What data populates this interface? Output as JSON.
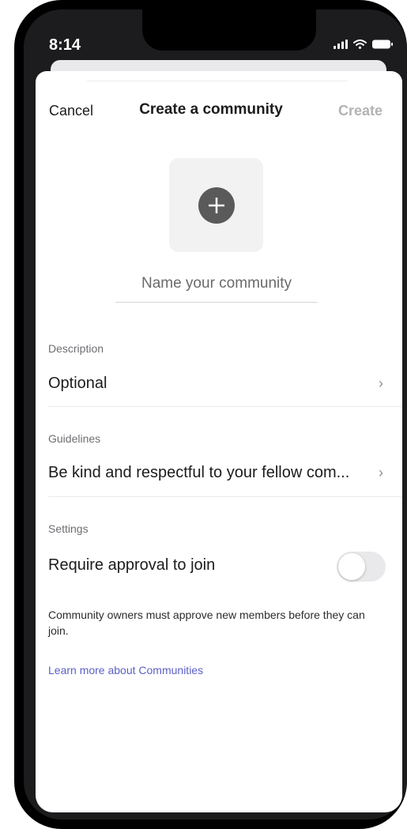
{
  "status_bar": {
    "time": "8:14"
  },
  "nav": {
    "cancel_label": "Cancel",
    "title": "Create a community",
    "create_label": "Create"
  },
  "photo": {
    "icon": "add-circle-icon"
  },
  "name_input": {
    "value": "",
    "placeholder": "Name your community"
  },
  "description": {
    "label": "Description",
    "value": "Optional"
  },
  "guidelines": {
    "label": "Guidelines",
    "value": "Be kind and respectful to your fellow com..."
  },
  "settings": {
    "label": "Settings",
    "approval_label": "Require approval to join",
    "approval_enabled": false,
    "hint": "Community owners must approve new members before they can join.",
    "learn_more": "Learn more about Communities"
  },
  "colors": {
    "link": "#5b5fc7",
    "disabled_text": "#b3b3b3",
    "icon_dark": "#5a5a5a"
  }
}
